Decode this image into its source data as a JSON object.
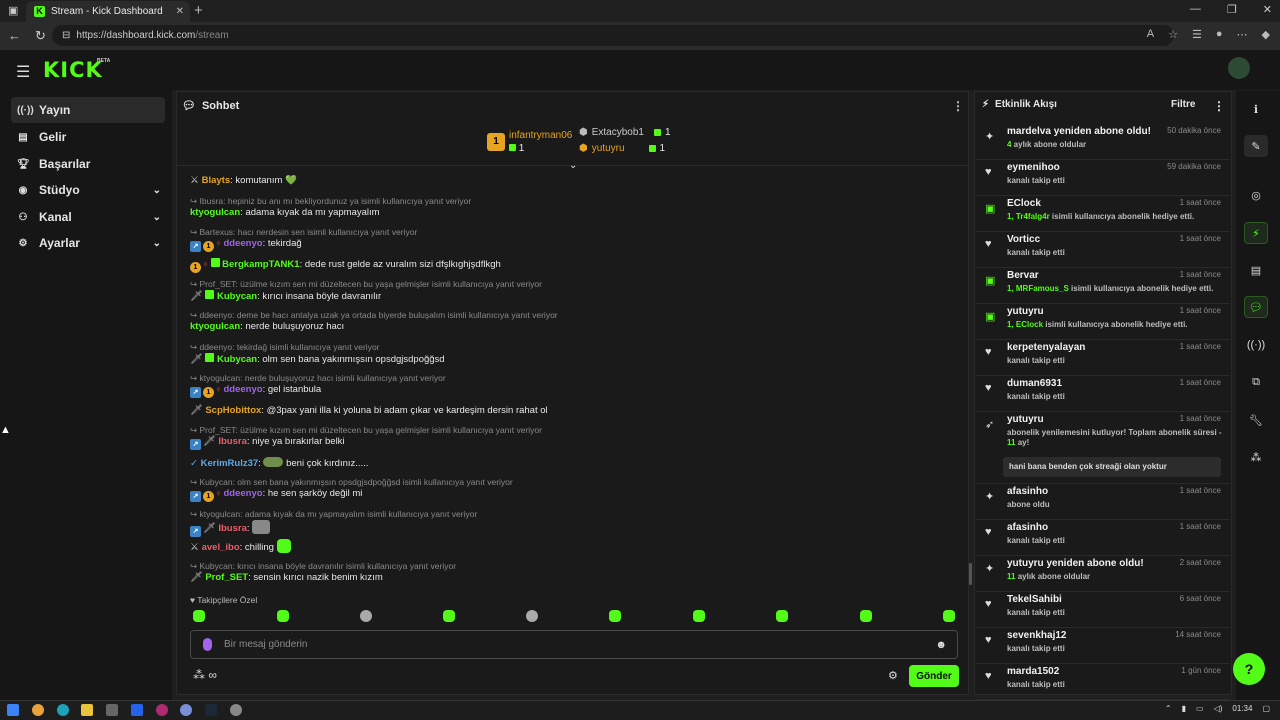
{
  "browser": {
    "tab_title": "Stream - Kick Dashboard",
    "url_host": "https://dashboard.kick.com",
    "url_path": "/stream"
  },
  "app": {
    "logo": "KICK",
    "logo_badge": "BETA"
  },
  "sidebar": {
    "items": [
      {
        "label": "Yayın",
        "icon": "broadcast-icon",
        "active": true
      },
      {
        "label": "Gelir",
        "icon": "revenue-icon"
      },
      {
        "label": "Başarılar",
        "icon": "trophy-icon"
      },
      {
        "label": "Stüdyo",
        "icon": "studio-icon",
        "expandable": true
      },
      {
        "label": "Kanal",
        "icon": "channel-icon",
        "expandable": true
      },
      {
        "label": "Ayarlar",
        "icon": "settings-icon",
        "expandable": true
      }
    ]
  },
  "chat": {
    "title": "Sohbet",
    "top_gifters": [
      {
        "name": "infantryman06",
        "count": "1",
        "rank": "1"
      },
      {
        "name": "Extacybob1",
        "count": "1"
      },
      {
        "name": "yutuyru",
        "count": "1"
      }
    ],
    "messages": [
      {
        "user": "Blayts",
        "color": "#e7a420",
        "text": "komutanım 💚"
      },
      {
        "reply": "Ibusra: hepiniz bu anı mı bekliyordunuz ya isimli kullanıcıya yanıt veriyor",
        "user": "ktyogulcan",
        "color": "#53fc18",
        "text": "adama kıyak da mı yapmayalım"
      },
      {
        "reply": "Bartexus: hacı nerdesin sen isimli kullanıcıya yanıt veriyor",
        "user": "ddeenyo",
        "color": "#a065e8",
        "text": "tekirdağ"
      },
      {
        "user": "BergkampTANK1",
        "color": "#53fc18",
        "text": "dede rust gelde az vuralım sizi dfşlkıghjşdflkgh"
      },
      {
        "reply": "Prof_SET: üzülme kızım sen mi düzeltecen bu yaşa gelmişler isimli kullanıcıya yanıt veriyor",
        "user": "Kubycan",
        "color": "#53fc18",
        "text": "kırıcı insana böyle davranılır"
      },
      {
        "reply": "ddeenyo: deme be hacı antalya uzak ya ortada biyerde buluşalım isimli kullanıcıya yanıt veriyor",
        "user": "ktyogulcan",
        "color": "#53fc18",
        "text": "nerde buluşuyoruz hacı"
      },
      {
        "reply": "ddeenyo: tekirdağ isimli kullanıcıya yanıt veriyor",
        "user": "Kubycan",
        "color": "#53fc18",
        "text": "olm sen bana yakınmışsın opsdgjsdpoğğsd"
      },
      {
        "reply": "ktyogulcan: nerde buluşuyoruz hacı isimli kullanıcıya yanıt veriyor",
        "user": "ddeenyo",
        "color": "#a065e8",
        "text": "gel istanbula"
      },
      {
        "user": "ScpHobittox",
        "color": "#e7a420",
        "text": "@3pax yani illa ki yoluna bi adam çıkar ve kardeşim dersin rahat ol"
      },
      {
        "reply": "Prof_SET: üzülme kızım sen mi düzeltecen bu yaşa gelmişler isimli kullanıcıya yanıt veriyor",
        "user": "Ibusra",
        "color": "#e85d6b",
        "text": "niye ya bırakırlar belki"
      },
      {
        "user": "KerimRulz37",
        "color": "#5fa8e8",
        "text": "beni çok kırdınız....."
      },
      {
        "reply": "Kubycan: olm sen bana yakınmışsın opsdgjsdpoğğsd isimli kullanıcıya yanıt veriyor",
        "user": "ddeenyo",
        "color": "#a065e8",
        "text": "he sen şarköy değil mi"
      },
      {
        "reply": "ktyogulcan: adama kıyak da mı yapmayalım isimli kullanıcıya yanıt veriyor",
        "user": "Ibusra",
        "color": "#e85d6b",
        "text": ""
      },
      {
        "user": "avel_ibo",
        "color": "#e85d6b",
        "text": "chilling"
      },
      {
        "reply": "Kubycan: kırıcı insana böyle davranılır isimli kullanıcıya yanıt veriyor",
        "user": "Prof_SET",
        "color": "#53fc18",
        "text": "sensin kırıcı nazik benim kızım"
      }
    ],
    "followers_only": "Takipçilere Özel",
    "input_placeholder": "Bir mesaj gönderin",
    "send_label": "Gönder"
  },
  "activity": {
    "title": "Etkinlik Akışı",
    "filter_label": "Filtre",
    "items": [
      {
        "icon": "sparkle-icon",
        "name": "mardelva yeniden abone oldu!",
        "time": "50 dakika önce",
        "sub_g": "4",
        "sub": " aylık abone oldular"
      },
      {
        "icon": "heart-icon",
        "name": "eymenihoo",
        "time": "59 dakika önce",
        "sub_g": "",
        "sub": "kanalı takip etti"
      },
      {
        "icon": "gift-icon",
        "name": "EClock",
        "time": "1 saat önce",
        "sub_g": "1, Tr4falg4r",
        "sub": " isimli kullanıcıya abonelik hediye etti."
      },
      {
        "icon": "heart-icon",
        "name": "Vorticc",
        "time": "1 saat önce",
        "sub_g": "",
        "sub": "kanalı takip etti"
      },
      {
        "icon": "gift-icon",
        "name": "Bervar",
        "time": "1 saat önce",
        "sub_g": "1, MRFamous_S",
        "sub": " isimli kullanıcıya abonelik hediye etti."
      },
      {
        "icon": "gift-icon",
        "name": "yutuyru",
        "time": "1 saat önce",
        "sub_g": "1, EClock",
        "sub": " isimli kullanıcıya abonelik hediye etti."
      },
      {
        "icon": "heart-icon",
        "name": "kerpetenyalayan",
        "time": "1 saat önce",
        "sub_g": "",
        "sub": "kanalı takip etti"
      },
      {
        "icon": "heart-icon",
        "name": "duman6931",
        "time": "1 saat önce",
        "sub_g": "",
        "sub": "kanalı takip etti"
      },
      {
        "icon": "resub-icon",
        "name": "yutuyru",
        "time": "1 saat önce",
        "sub_g": "",
        "sub": "abonelik yenilemesini kutluyor! Toplam abonelik süresi -",
        "sub2_g": "11",
        "sub2": " ay!",
        "quote": "hani bana benden çok streaği olan yoktur"
      },
      {
        "icon": "sparkle-icon",
        "name": "afasinho",
        "time": "1 saat önce",
        "sub_g": "",
        "sub": "abone oldu"
      },
      {
        "icon": "heart-icon",
        "name": "afasinho",
        "time": "1 saat önce",
        "sub_g": "",
        "sub": "kanalı takip etti"
      },
      {
        "icon": "sparkle-icon",
        "name": "yutuyru yeniden abone oldu!",
        "time": "2 saat önce",
        "sub_g": "11",
        "sub": " aylık abone oldular"
      },
      {
        "icon": "heart-icon",
        "name": "TekelSahibi",
        "time": "6 saat önce",
        "sub_g": "",
        "sub": "kanalı takip etti"
      },
      {
        "icon": "heart-icon",
        "name": "sevenkhaj12",
        "time": "14 saat önce",
        "sub_g": "",
        "sub": "kanalı takip etti"
      },
      {
        "icon": "heart-icon",
        "name": "marda1502",
        "time": "1 gün önce",
        "sub_g": "",
        "sub": "kanalı takip etti"
      }
    ]
  },
  "taskbar": {
    "time": "01:34"
  },
  "colors": {
    "accent": "#53fc18",
    "background": "#1f1f1f",
    "panel": "#1a1a1a"
  }
}
